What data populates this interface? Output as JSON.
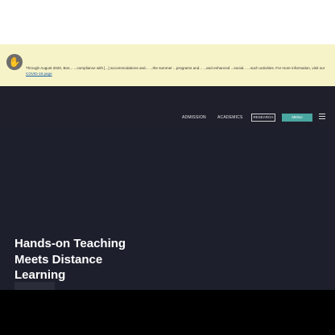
{
  "banner": {
    "icon": "hand-icon",
    "text": "Through August 2020, Bos... ...compliance with [...] accommodations and... ...the summer ...programs and... ...and enhanced ...social... ...such activities. For more information, visit our",
    "link_text": "COVID-19 page"
  },
  "nav": {
    "items": [
      "ADMISSION",
      "ACADEMICS",
      "RESEARCH"
    ],
    "search_label": "",
    "menu_label": "MENU"
  },
  "hero": {
    "title": "Hands-on Teaching Meets Distance Learning",
    "button_label": ""
  }
}
